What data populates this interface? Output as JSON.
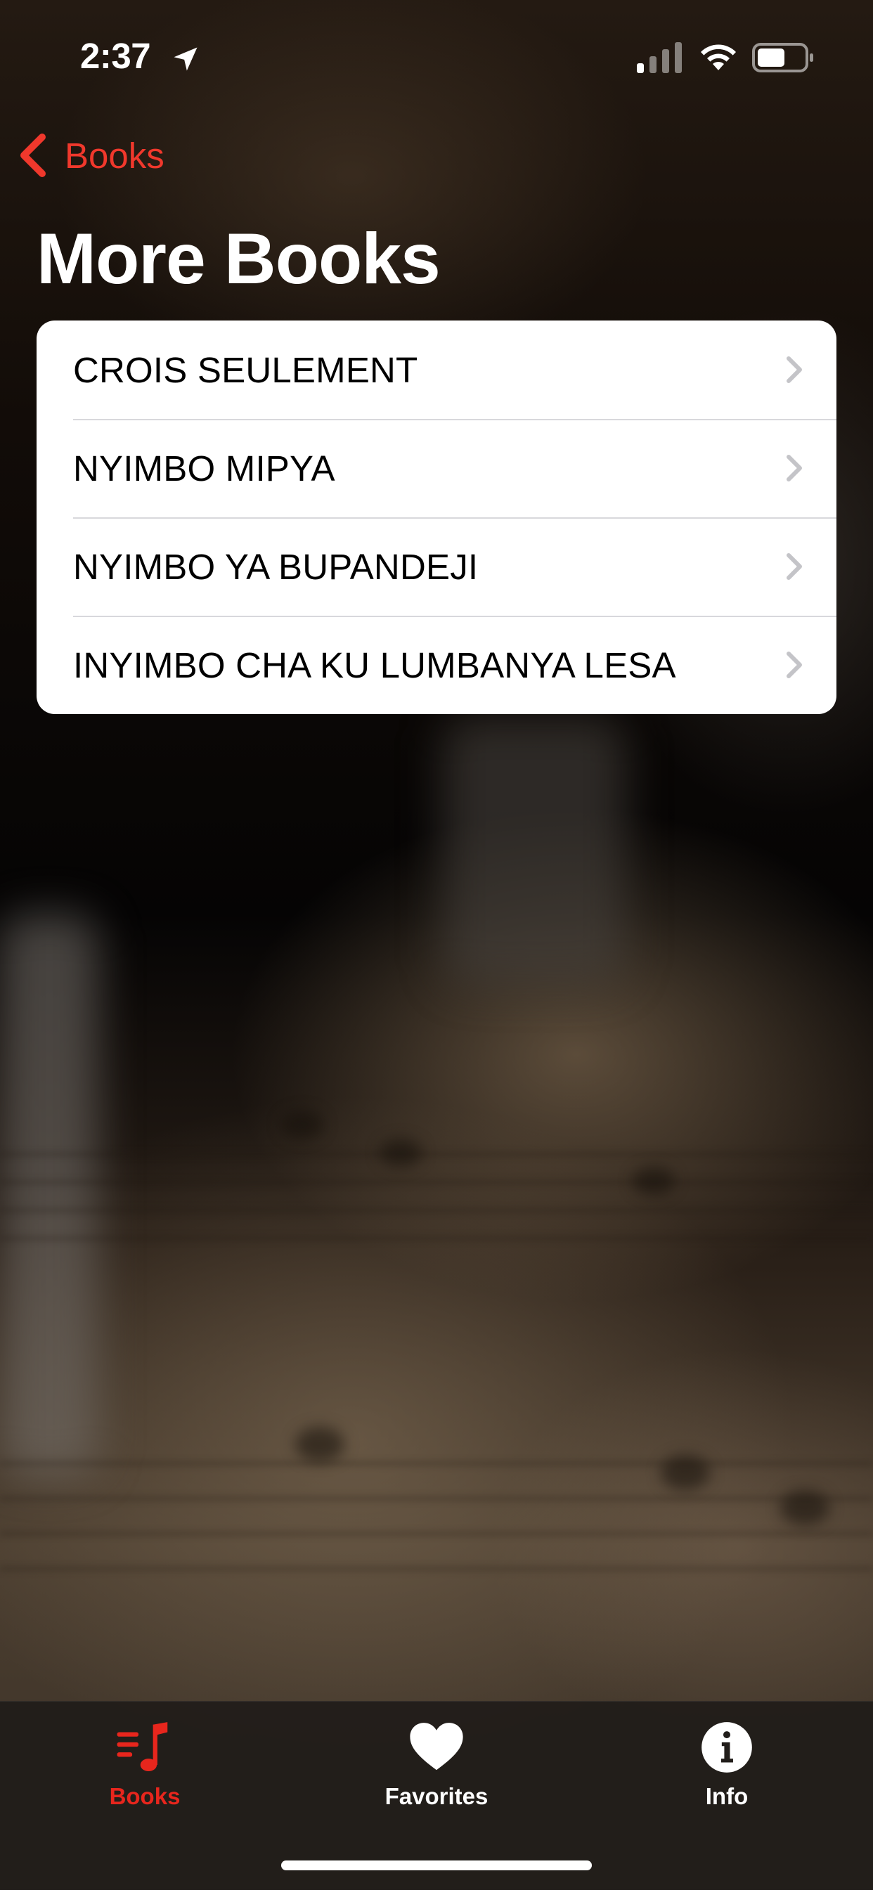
{
  "status_bar": {
    "time": "2:37",
    "icons": [
      "location-arrow-icon",
      "cellular-signal-icon",
      "wifi-icon",
      "battery-icon"
    ]
  },
  "nav": {
    "back_label": "Books",
    "title": "More Books"
  },
  "books": [
    {
      "label": "CROIS SEULEMENT"
    },
    {
      "label": "NYIMBO MIPYA"
    },
    {
      "label": "NYIMBO YA BUPANDEJI"
    },
    {
      "label": "INYIMBO CHA KU LUMBANYA LESA"
    }
  ],
  "tab_bar": {
    "tabs": [
      {
        "label": "Books",
        "icon": "music-list-icon",
        "active": true
      },
      {
        "label": "Favorites",
        "icon": "heart-icon",
        "active": false
      },
      {
        "label": "Info",
        "icon": "info-icon",
        "active": false
      }
    ]
  },
  "colors": {
    "accent": "#f0382c",
    "active_tab": "#e8261d",
    "list_background": "#ffffff",
    "tab_bar_background": "#211d1a"
  }
}
